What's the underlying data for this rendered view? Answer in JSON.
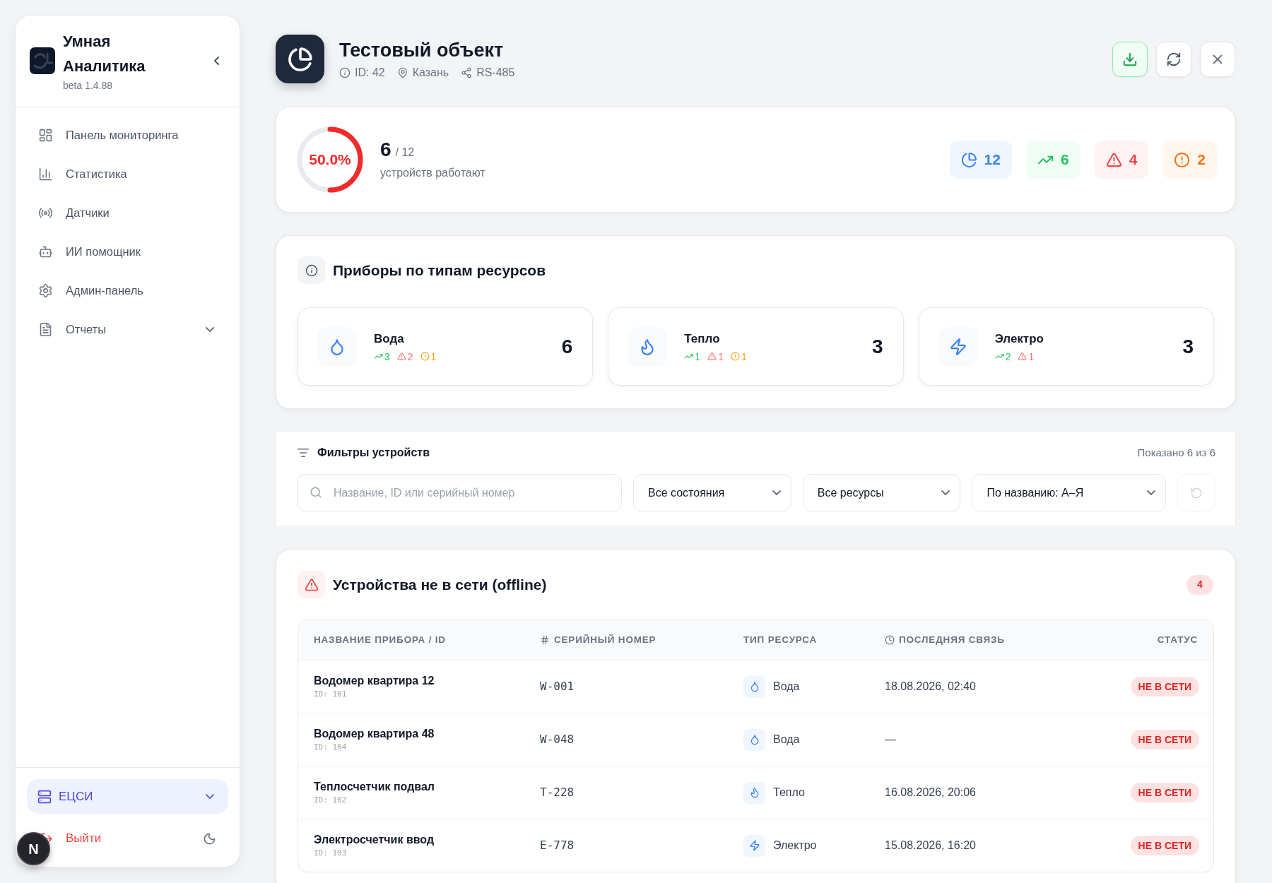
{
  "sidebar": {
    "brand": {
      "title": "Умная Аналитика",
      "version": "beta 1.4.88"
    },
    "nav_items": [
      {
        "label": "Панель мониторинга",
        "kind": "link",
        "selected": false
      },
      {
        "label": "Статистика",
        "kind": "link",
        "selected": false
      },
      {
        "label": "Датчики",
        "kind": "link",
        "selected": false
      },
      {
        "label": "ИИ помощник",
        "kind": "link",
        "selected": false
      },
      {
        "label": "Админ-панель",
        "kind": "link",
        "selected": false
      },
      {
        "label": "Отчеты",
        "kind": "group",
        "selected": false,
        "expanded": false
      }
    ],
    "workspace": {
      "label": "ЕЦСИ",
      "expanded": false
    },
    "logout": {
      "label": "Выйти"
    }
  },
  "dev_indicator": {
    "label": "N"
  },
  "header": {
    "title": "Тестовый объект",
    "meta": [
      "ID: 42",
      "Казань",
      "RS-485"
    ]
  },
  "summary": {
    "gauge": {
      "level": 0.5,
      "label": "50.0%"
    },
    "working": "6",
    "total": "/ 12",
    "caption": "устройств работают",
    "counters": [
      {
        "kind": "total",
        "value": "12"
      },
      {
        "kind": "online",
        "value": "6"
      },
      {
        "kind": "offline",
        "value": "4"
      },
      {
        "kind": "warning",
        "value": "2"
      }
    ]
  },
  "resources": {
    "title": "Приборы по типам ресурсов",
    "items": [
      {
        "kind": "water",
        "name": "Вода",
        "count": "6",
        "stats": [
          {
            "kind": "online",
            "value": "3"
          },
          {
            "kind": "offline",
            "value": "2"
          },
          {
            "kind": "warning",
            "value": "1"
          }
        ]
      },
      {
        "kind": "heat",
        "name": "Тепло",
        "count": "3",
        "stats": [
          {
            "kind": "online",
            "value": "1"
          },
          {
            "kind": "offline",
            "value": "1"
          },
          {
            "kind": "warning",
            "value": "1"
          }
        ]
      },
      {
        "kind": "power",
        "name": "Электро",
        "count": "3",
        "stats": [
          {
            "kind": "online",
            "value": "2"
          },
          {
            "kind": "offline",
            "value": "1"
          }
        ]
      }
    ]
  },
  "filters": {
    "title": "Фильтры устройств",
    "shown": "Показано 6 из 6",
    "search": {
      "placeholder": "Название, ID или серийный номер"
    },
    "selects": [
      "Все состояния",
      "Все ресурсы",
      "По названию: А–Я"
    ],
    "reset": {
      "disabled": true
    }
  },
  "offline": {
    "title": "Устройства не в сети (offline)",
    "count": "4",
    "columns": [
      "НАЗВАНИЕ ПРИБОРА / ID",
      "СЕРИЙНЫЙ НОМЕР",
      "ТИП РЕСУРСА",
      "ПОСЛЕДНЯЯ СВЯЗЬ",
      "СТАТУС"
    ],
    "rows": [
      {
        "name": "Водомер квартира 12",
        "id": "ID: 101",
        "serial": "W-001",
        "resource": {
          "kind": "water",
          "label": "Вода"
        },
        "last_seen": "18.08.2026, 02:40",
        "status": {
          "kind": "offline",
          "label": "НЕ В СЕТИ"
        }
      },
      {
        "name": "Водомер квартира 48",
        "id": "ID: 104",
        "serial": "W-048",
        "resource": {
          "kind": "water",
          "label": "Вода"
        },
        "last_seen": "—",
        "status": {
          "kind": "offline",
          "label": "НЕ В СЕТИ"
        }
      },
      {
        "name": "Теплосчетчик подвал",
        "id": "ID: 102",
        "serial": "T-228",
        "resource": {
          "kind": "heat",
          "label": "Тепло"
        },
        "last_seen": "16.08.2026, 20:06",
        "status": {
          "kind": "offline",
          "label": "НЕ В СЕТИ"
        }
      },
      {
        "name": "Электросчетчик ввод",
        "id": "ID: 103",
        "serial": "E-778",
        "resource": {
          "kind": "power",
          "label": "Электро"
        },
        "last_seen": "15.08.2026, 16:20",
        "status": {
          "kind": "offline",
          "label": "НЕ В СЕТИ"
        }
      }
    ]
  }
}
